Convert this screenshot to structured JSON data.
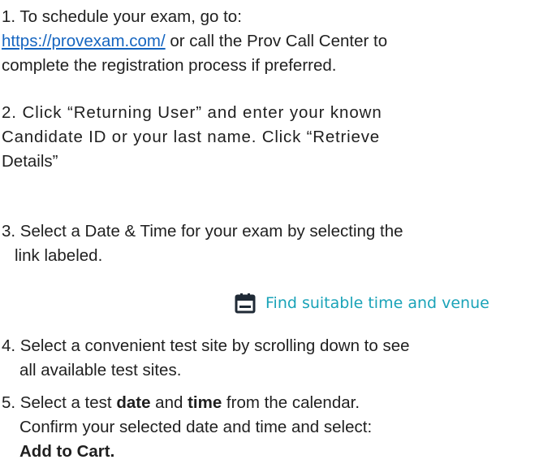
{
  "step1": {
    "prefix": "1. To schedule your exam, go to:",
    "link": "https://provexam.com/",
    "suffix_line2": " or call the Prov Call Center to",
    "line3": "complete the registration process if preferred."
  },
  "step2": {
    "line1": "2. Click “Returning User” and enter your known",
    "line2": "Candidate ID or your last name. Click “Retrieve",
    "line3": "Details”"
  },
  "step3": {
    "line1": "3. Select a Date & Time for your exam by selecting the",
    "line2": "link labeled."
  },
  "callout": {
    "icon": "calendar-icon",
    "text": "Find suitable time and venue",
    "color": "#1aa3b8"
  },
  "step4": {
    "line1": "4. Select a convenient test site by scrolling down to see",
    "line2": "all available test sites."
  },
  "step5": {
    "line1_a": "5. Select a test ",
    "line1_b": "date",
    "line1_c": " and ",
    "line1_d": "time",
    "line1_e": " from the calendar.",
    "line2": "Confirm your selected date and time and select:",
    "line3": "Add to Cart."
  },
  "colors": {
    "link": "#1565c0",
    "text": "#1f1f1f"
  }
}
